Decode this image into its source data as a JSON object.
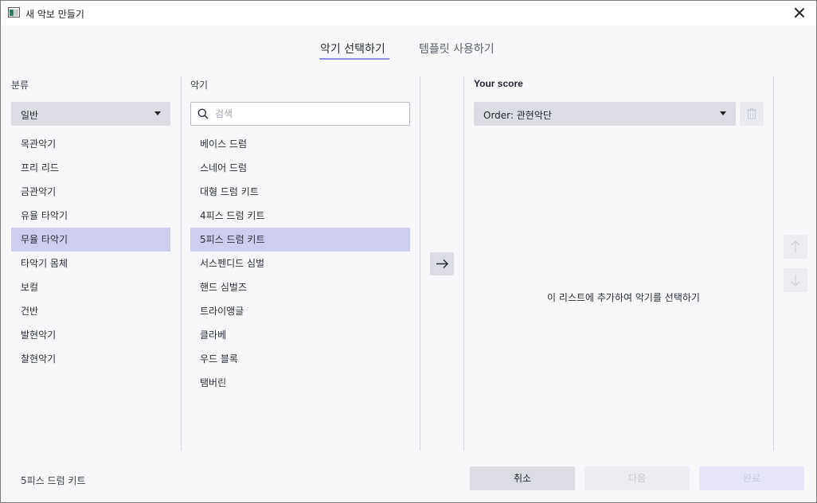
{
  "window": {
    "title": "새 악보 만들기"
  },
  "tabs": [
    {
      "label": "악기 선택하기",
      "active": true
    },
    {
      "label": "템플릿 사용하기",
      "active": false
    }
  ],
  "category": {
    "label": "분류",
    "dropdown_value": "일반",
    "items": [
      "목관악기",
      "프리 리드",
      "금관악기",
      "유율 타악기",
      "무율 타악기",
      "타악기 몸체",
      "보컬",
      "건반",
      "발현악기",
      "찰현악기"
    ],
    "selected_index": 4
  },
  "instruments": {
    "label": "악기",
    "search_placeholder": "검색",
    "items": [
      "베이스 드럼",
      "스네어 드럼",
      "대형 드럼 키트",
      "4피스 드럼 키트",
      "5피스 드럼 키트",
      "서스펜디드 심벌",
      "핸드 심벌즈",
      "트라이앵글",
      "클라베",
      "우드 블록",
      "탬버린"
    ],
    "selected_index": 4
  },
  "score": {
    "label": "Your score",
    "order_value": "Order: 관현악단",
    "empty_message": "이 리스트에 추가하여 악기를 선택하기"
  },
  "status": {
    "selected_instrument": "5피스 드럼 키트"
  },
  "buttons": {
    "cancel": "취소",
    "next": "다음",
    "done": "완료"
  },
  "icons": {
    "add": "arrow-right-icon",
    "delete": "trash-icon",
    "move_up": "arrow-up-icon",
    "move_down": "arrow-down-icon",
    "search": "search-icon",
    "close": "close-icon"
  },
  "colors": {
    "accent": "#8b8fe8",
    "selection": "#cdcdf0",
    "button": "#dcdde4"
  }
}
